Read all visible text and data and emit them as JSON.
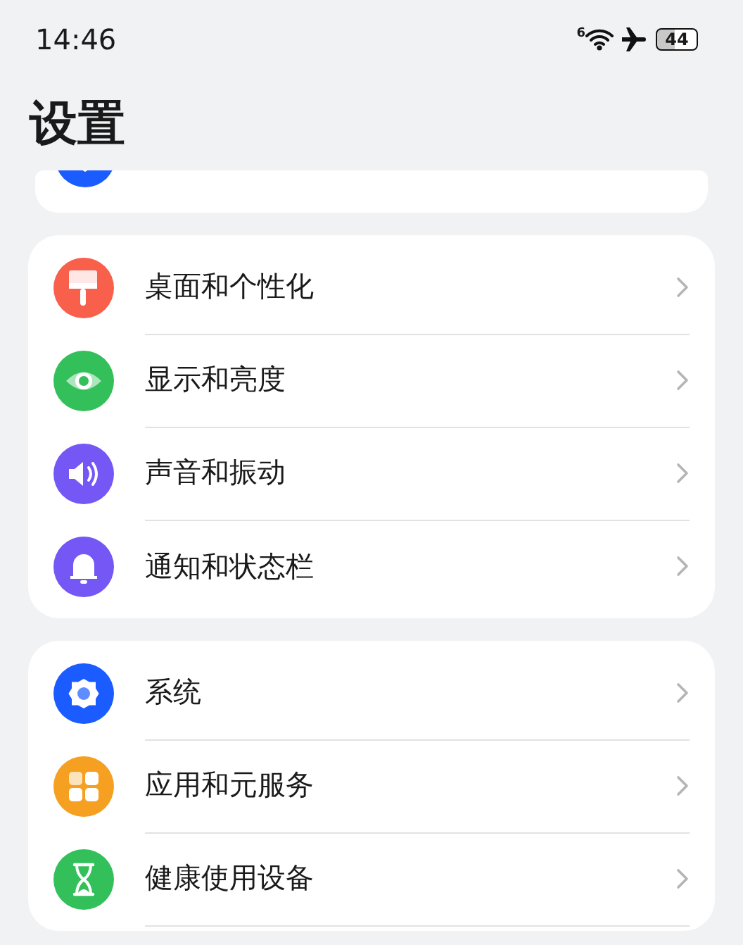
{
  "status_bar": {
    "time": "14:46",
    "wifi_badge": "6",
    "battery": "44"
  },
  "title": "设置",
  "partial_card": {
    "color": "#1a5cff"
  },
  "groups": [
    {
      "items": [
        {
          "label": "桌面和个性化",
          "color": "#f8604c"
        },
        {
          "label": "显示和亮度",
          "color": "#33c05a"
        },
        {
          "label": "声音和振动",
          "color": "#7457f5"
        },
        {
          "label": "通知和状态栏",
          "color": "#7457f5"
        }
      ]
    },
    {
      "items": [
        {
          "label": "系统",
          "color": "#1a5cff"
        },
        {
          "label": "应用和元服务",
          "color": "#f5a021"
        },
        {
          "label": "健康使用设备",
          "color": "#33c05a"
        }
      ]
    }
  ]
}
